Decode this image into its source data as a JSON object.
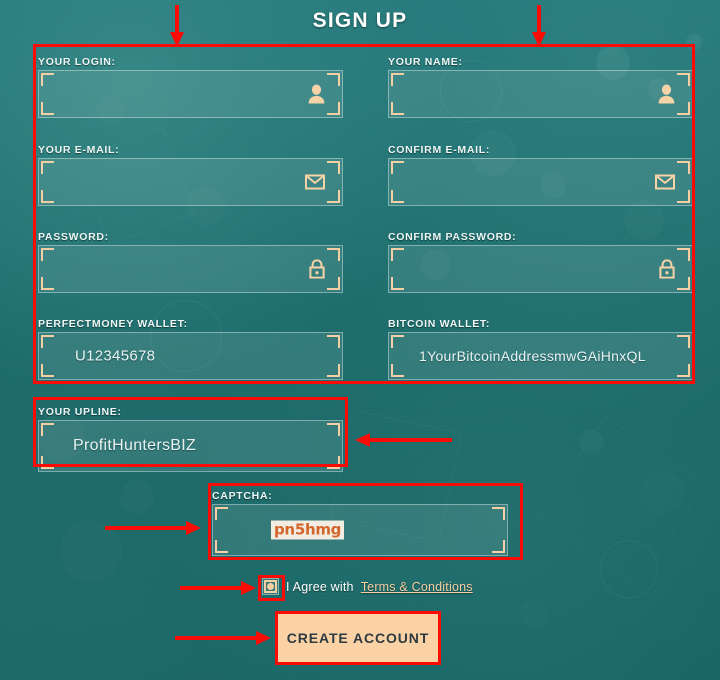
{
  "page": {
    "title": "SIGN UP",
    "background_color": "#1d6d6d",
    "accent_color": "#fbd2a6",
    "annotation_color": "#f90b06"
  },
  "form": {
    "fields": [
      {
        "label": "YOUR LOGIN:",
        "value": "",
        "icon": "user-icon",
        "name": "login"
      },
      {
        "label": "YOUR NAME:",
        "value": "",
        "icon": "user-icon",
        "name": "name"
      },
      {
        "label": "YOUR E-MAIL:",
        "value": "",
        "icon": "envelope-icon",
        "name": "email"
      },
      {
        "label": "CONFIRM E-MAIL:",
        "value": "",
        "icon": "envelope-icon",
        "name": "confirm-email"
      },
      {
        "label": "PASSWORD:",
        "value": "",
        "icon": "lock-icon",
        "name": "password"
      },
      {
        "label": "CONFIRM PASSWORD:",
        "value": "",
        "icon": "lock-icon",
        "name": "confirm-password"
      },
      {
        "label": "PERFECTMONEY WALLET:",
        "value": "U12345678",
        "icon": "",
        "name": "perfectmoney-wallet"
      },
      {
        "label": "BITCOIN WALLET:",
        "value": "1YourBitcoinAddressmwGAiHnxQL",
        "icon": "",
        "name": "bitcoin-wallet"
      }
    ],
    "upline": {
      "label": "YOUR UPLINE:",
      "value": "ProfitHuntersBIZ"
    },
    "captcha": {
      "label": "CAPTCHA:",
      "value": "",
      "image_text": "pn5hmg"
    },
    "agree": {
      "checked": true,
      "text": "I Agree with",
      "link_text": "Terms & Conditions"
    },
    "submit": {
      "label": "CREATE ACCOUNT"
    }
  }
}
